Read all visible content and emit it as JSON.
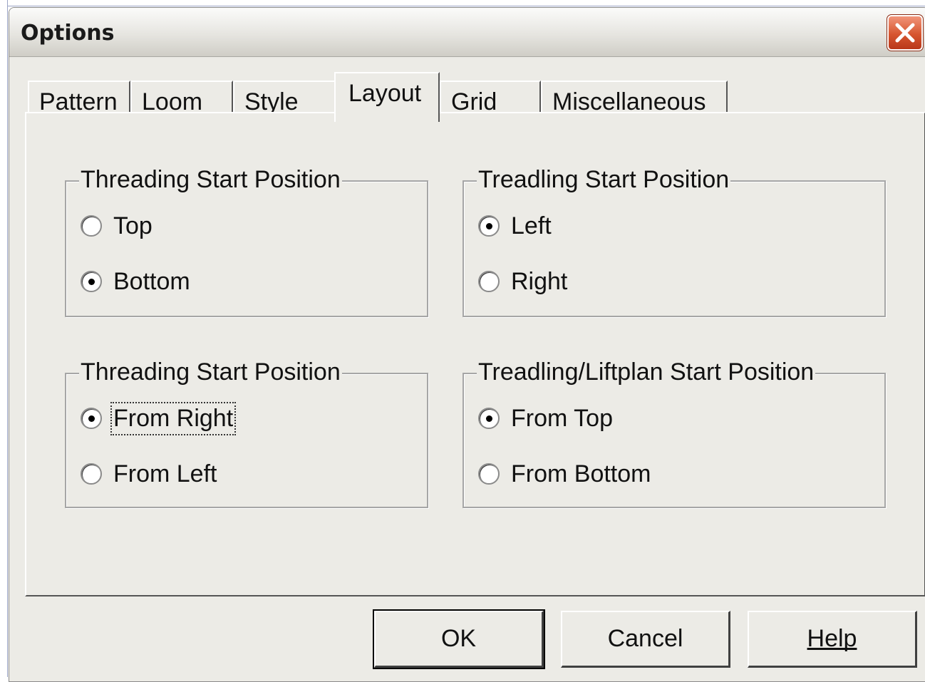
{
  "window": {
    "title": "Options"
  },
  "tabs": [
    {
      "label": "Pattern"
    },
    {
      "label": "Loom"
    },
    {
      "label": "Style"
    },
    {
      "label": "Layout",
      "active": true
    },
    {
      "label": "Grid"
    },
    {
      "label": "Miscellaneous"
    }
  ],
  "groups": {
    "threading_vertical": {
      "title": "Threading Start Position",
      "options": [
        {
          "label": "Top",
          "selected": false
        },
        {
          "label": "Bottom",
          "selected": true
        }
      ]
    },
    "treadling_horizontal": {
      "title": "Treadling Start Position",
      "options": [
        {
          "label": "Left",
          "selected": true
        },
        {
          "label": "Right",
          "selected": false
        }
      ]
    },
    "threading_horizontal": {
      "title": "Threading Start Position",
      "options": [
        {
          "label": "From Right",
          "selected": true
        },
        {
          "label": "From Left",
          "selected": false
        }
      ]
    },
    "treadling_liftplan": {
      "title": "Treadling/Liftplan Start Position",
      "options": [
        {
          "label": "From Top",
          "selected": true
        },
        {
          "label": "From Bottom",
          "selected": false
        }
      ]
    }
  },
  "buttons": {
    "ok": "OK",
    "cancel": "Cancel",
    "help": "Help"
  },
  "icons": {
    "close": "close-icon"
  },
  "colors": {
    "face": "#ecebe6",
    "close_red": "#d6552f"
  }
}
